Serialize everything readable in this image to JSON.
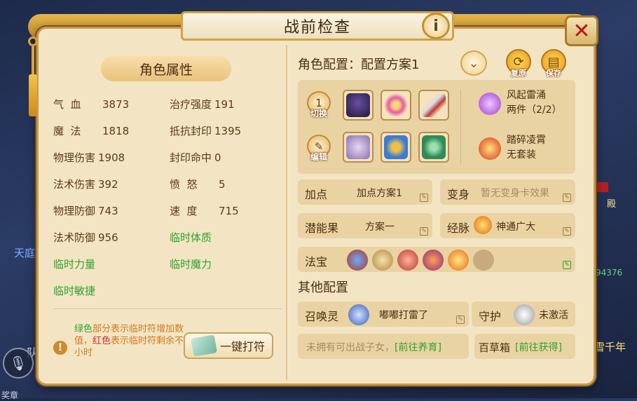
{
  "window": {
    "title": "战前检查"
  },
  "background": {
    "left_label": "天庭",
    "right_label_1": "殿",
    "right_label_2": "94376",
    "right_label_3": "雪千年",
    "queue_label": "队",
    "bottom_label": "奖章"
  },
  "attributes": {
    "header": "角色属性",
    "stats_left": [
      {
        "label": "气  血",
        "value": "3873"
      },
      {
        "label": "魔  法",
        "value": "1818"
      },
      {
        "label": "物理伤害",
        "value": "1908"
      },
      {
        "label": "法术伤害",
        "value": "392"
      },
      {
        "label": "物理防御",
        "value": "743"
      },
      {
        "label": "法术防御",
        "value": "956"
      }
    ],
    "stats_right": [
      {
        "label": "治疗强度",
        "value": "191"
      },
      {
        "label": "抵抗封印",
        "value": "1395"
      },
      {
        "label": "封印命中",
        "value": "0"
      },
      {
        "label": "愤  怒",
        "value": "5"
      },
      {
        "label": "速  度",
        "value": "715"
      }
    ],
    "temp": {
      "vitality": "临时体质",
      "strength": "临时力量",
      "magic": "临时魔力",
      "agility": "临时敏捷"
    },
    "tip": {
      "part1_green": "绿色",
      "part2": "部分表示临时符增加数值，",
      "part3_red": "红色",
      "part4": "表示临时符剩余不足1小时"
    },
    "charm_button": "一键打符"
  },
  "role_config": {
    "title": "角色配置：配置方案1",
    "restore_label": "复原",
    "save_label": "保存",
    "switch_label": "切换",
    "switch_badge": "1",
    "edit_label": "编辑",
    "set_1_name": "风起雷涌",
    "set_1_desc": "两件（2/2）",
    "set_2_name": "踏碎凌霄",
    "set_2_desc": "无套装"
  },
  "rows": {
    "points_label": "加点",
    "points_value": "加点方案1",
    "transform_label": "变身",
    "transform_value": "暂无变身卡效果",
    "potential_label": "潜能果",
    "potential_value": "方案一",
    "meridian_label": "经脉",
    "meridian_value": "神通广大",
    "treasure_label": "法宝"
  },
  "other_config": {
    "title": "其他配置",
    "summon_label": "召唤灵",
    "summon_value": "嘟嘟打雷了",
    "guard_label": "守护",
    "guard_value": "未激活",
    "child_text": "未拥有可出战子女，",
    "child_link": "[前往养育]",
    "herb_label": "百草箱",
    "herb_link": "[前往获得]"
  },
  "colors": {
    "panel_bg": "#f3e5c4",
    "temp_green": "#2fa12f",
    "warning_red": "#d62828",
    "close_red": "#c0141b"
  },
  "icons": {
    "info": "i",
    "close": "✕",
    "dropdown": "⌄",
    "restore": "⟳",
    "save": "▤",
    "edit": "✎"
  }
}
